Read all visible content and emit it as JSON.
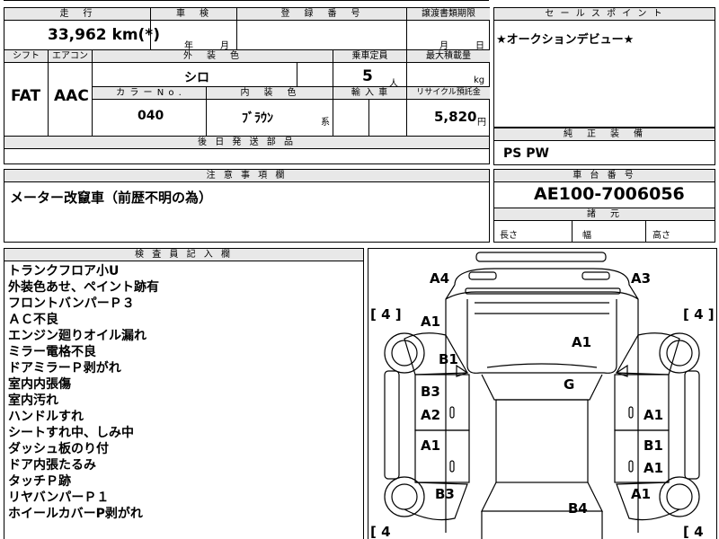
{
  "spec": {
    "headers": {
      "mileage": "走　行",
      "inspection": "車　検",
      "registration": "登　録　番　号",
      "transfer": "譲渡書類期限",
      "shift": "シフト",
      "aircon": "エアコン",
      "exterior_color": "外　装　色",
      "capacity": "乗車定員",
      "max_load": "最大積載量",
      "color_no": "カ ラ ー N o .",
      "interior_color": "内　装　色",
      "import": "輸 入 車",
      "recycle": "リサイクル預託金",
      "later_parts": "後 日 発 送 部 品"
    },
    "values": {
      "mileage": "33,962 km(*)",
      "inspection_year": "年",
      "inspection_month": "月",
      "transfer_month": "月",
      "transfer_day": "日",
      "shift": "FAT",
      "aircon": "AAC",
      "exterior_color": "シロ",
      "capacity": "5",
      "capacity_unit": "人",
      "load_unit": "kg",
      "color_no": "040",
      "interior_color": "ﾌﾞﾗｳﾝ",
      "interior_suffix": "系",
      "recycle": "5,820",
      "recycle_unit": "円"
    }
  },
  "sales": {
    "header": "セ ー ル ス ポ イ ン ト",
    "text": "★オークションデビュー★"
  },
  "equipment": {
    "header": "純　正　装　備",
    "text": "PS PW"
  },
  "notes": {
    "header": "注 意 事 項 欄",
    "text": "メーター改竄車（前歴不明の為）"
  },
  "chassis": {
    "header": "車 台 番 号",
    "number": "AE100-7006056",
    "dims_header": "諸　元",
    "length": "長さ",
    "width": "幅",
    "height": "高さ"
  },
  "inspector": {
    "header": "検 査 員 記 入 欄",
    "lines": [
      "トランクフロア小U",
      "外装色あせ、ペイント跡有",
      "フロントバンパーＰ３",
      "ＡＣ不良",
      "エンジン廻りオイル漏れ",
      "ミラー電格不良",
      "ドアミラーＰ剥がれ",
      "室内内張傷",
      "室内汚れ",
      "ハンドルすれ",
      "シートすれ中、しみ中",
      "ダッシュ板のり付",
      "ドア内張たるみ",
      "タッチＰ跡",
      "リヤバンパーＰ１",
      "ホイールカバーP剥がれ"
    ]
  },
  "diagram": {
    "marks": {
      "a4": "A4",
      "a3": "A3",
      "a1_left_front": "A1",
      "a1_hood": "A1",
      "b1_left_fender": "B1",
      "g_windshield": "G",
      "b3_left_door": "B3",
      "a2_left_door": "A2",
      "a1_right_door": "A1",
      "a1_left_rear_door": "A1",
      "b1_right_rear": "B1",
      "a1_right_rear": "A1",
      "b3_left_quarter": "B3",
      "a1_right_quarter": "A1",
      "b4_trunk": "B4"
    },
    "tires": {
      "front_left": "[ 4 ]",
      "front_right": "[ 4 ]",
      "rear_left": "[ 4",
      "rear_right": "[ 4"
    }
  }
}
